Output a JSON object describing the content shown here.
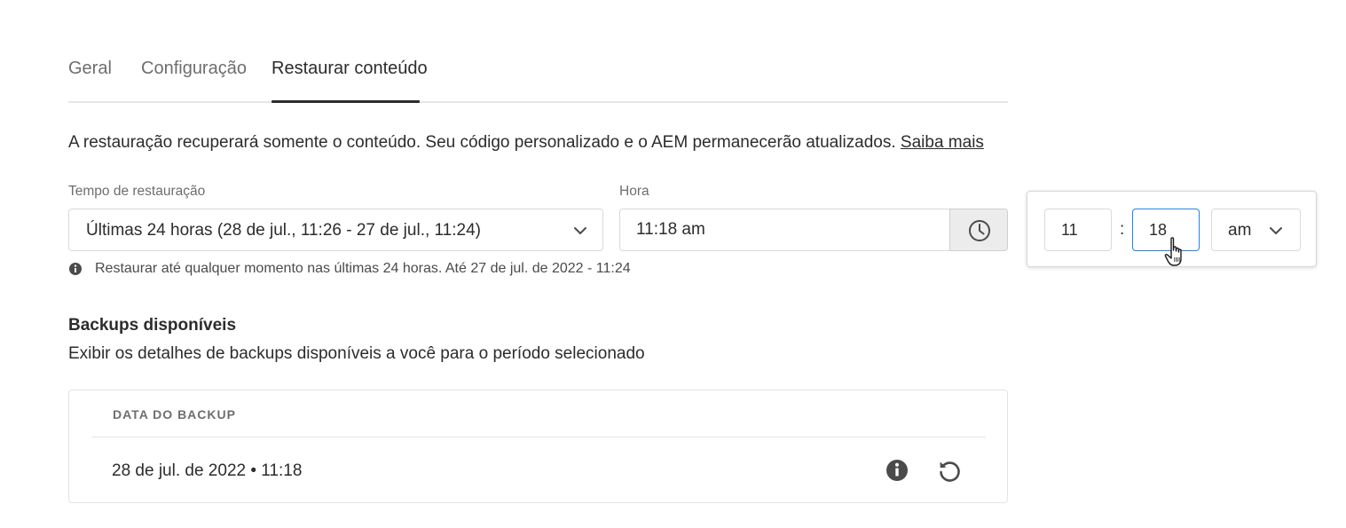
{
  "tabs": [
    {
      "label": "Geral",
      "active": false
    },
    {
      "label": "Configuração",
      "active": false
    },
    {
      "label": "Restaurar conteúdo",
      "active": true
    }
  ],
  "intro": {
    "text": "A restauração recuperará somente o conteúdo. Seu código personalizado e o AEM permanecerão atualizados. ",
    "link": "Saiba mais"
  },
  "restore_time": {
    "label": "Tempo de restauração",
    "value": "Últimas 24 horas (28 de jul., 11:26 - 27 de jul., 11:24)",
    "chevron_icon": "chevron-down-icon"
  },
  "hour": {
    "label": "Hora",
    "value": "11:18 am",
    "button_icon": "clock-icon"
  },
  "help_text": "Restaurar até qualquer momento nas últimas 24 horas. Até 27 de jul. de 2022 - 11:24",
  "backups": {
    "title": "Backups disponíveis",
    "description": "Exibir os detalhes de backups disponíveis a você para o período selecionado",
    "column_header": "DATA DO BACKUP",
    "rows": [
      {
        "date": "28 de jul. de 2022 • 11:18"
      }
    ]
  },
  "time_picker": {
    "hour": "11",
    "separator": ":",
    "minute": "18",
    "period": "am"
  },
  "colors": {
    "text": "#2c2c2c",
    "muted": "#6e6e6e",
    "border": "#dadada",
    "focus": "#2680eb"
  }
}
